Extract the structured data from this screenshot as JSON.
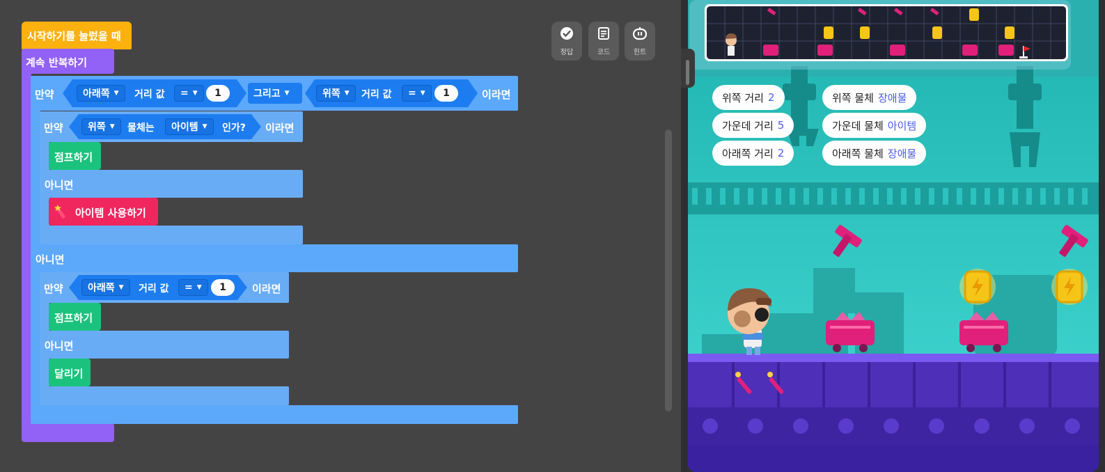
{
  "editor": {
    "hat_label": "시작하기를 눌렀을 때",
    "forever_label": "계속 반복하기",
    "outer_if": {
      "if_label": "만약",
      "left_dir": "아래쪽",
      "left_measure": "거리 값",
      "left_op": "=",
      "left_value": "1",
      "logic": "그리고",
      "right_dir": "위쪽",
      "right_measure": "거리 값",
      "right_op": "=",
      "right_value": "1",
      "then_label": "이라면"
    },
    "inner_if1": {
      "if_label": "만약",
      "dir": "위쪽",
      "obj_label": "물체는",
      "obj_value": "아이템",
      "question": "인가?",
      "then_label": "이라면",
      "then_action": "점프하기",
      "else_label": "아니면",
      "else_action": "아이템 사용하기"
    },
    "outer_else_label": "아니면",
    "inner_if2": {
      "if_label": "만약",
      "dir": "아래쪽",
      "measure": "거리 값",
      "op": "=",
      "value": "1",
      "then_label": "이라면",
      "then_action": "점프하기",
      "else_label": "아니면",
      "else_action": "달리기"
    },
    "tools": [
      {
        "label": "정답",
        "icon": "check-circle-icon"
      },
      {
        "label": "코드",
        "icon": "document-icon"
      },
      {
        "label": "힌트",
        "icon": "robot-icon"
      }
    ]
  },
  "game": {
    "stats_left": [
      {
        "label": "위쪽 거리",
        "value": "2"
      },
      {
        "label": "가운데 거리",
        "value": "5"
      },
      {
        "label": "아래쪽 거리",
        "value": "2"
      }
    ],
    "stats_right": [
      {
        "label": "위쪽 물체",
        "value": "장애물"
      },
      {
        "label": "가운데 물체",
        "value": "아이템"
      },
      {
        "label": "아래쪽 물체",
        "value": "장애물"
      }
    ],
    "colors": {
      "obstacle": "#e0207a",
      "coin": "#f5c518",
      "stage_bg": "#21b7b4",
      "floor": "#5a35c8"
    }
  }
}
